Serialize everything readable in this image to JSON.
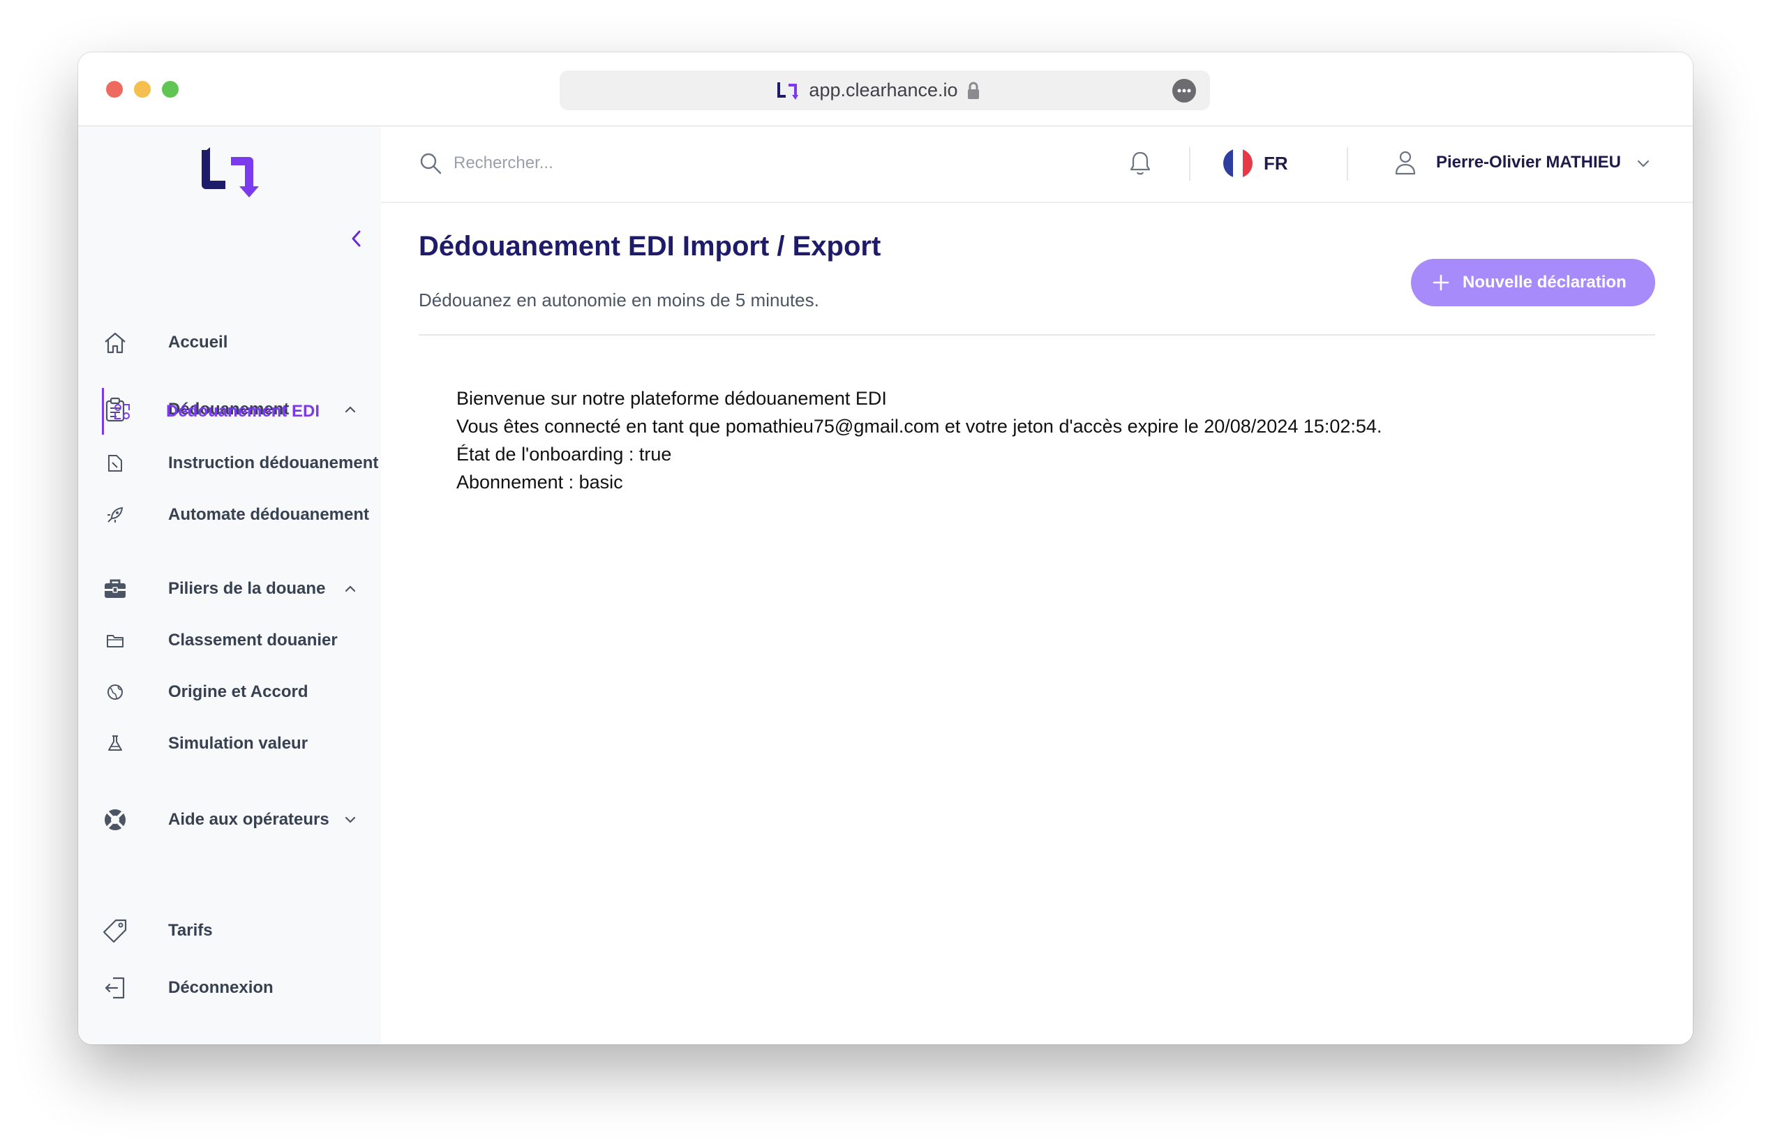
{
  "browser": {
    "url": "app.clearhance.io"
  },
  "sidebar": {
    "items": [
      {
        "label": "Accueil",
        "icon": "home-icon"
      },
      {
        "label": "Dédouanement",
        "icon": "clipboard-icon",
        "expanded": true
      },
      {
        "label": "Dédouanement EDI",
        "icon": "edi-icon",
        "active": true
      },
      {
        "label": "Instruction dédouanement",
        "icon": "document-icon"
      },
      {
        "label": "Automate dédouanement",
        "icon": "rocket-icon"
      },
      {
        "label": "Piliers de la douane",
        "icon": "briefcase-icon",
        "expanded": true
      },
      {
        "label": "Classement douanier",
        "icon": "folder-icon"
      },
      {
        "label": "Origine et Accord",
        "icon": "globe-icon"
      },
      {
        "label": "Simulation valeur",
        "icon": "flask-icon"
      },
      {
        "label": "Aide aux opérateurs",
        "icon": "lifebuoy-icon",
        "expanded": false
      },
      {
        "label": "Tarifs",
        "icon": "tag-icon"
      },
      {
        "label": "Déconnexion",
        "icon": "logout-icon"
      }
    ]
  },
  "header": {
    "search_placeholder": "Rechercher...",
    "language": "FR",
    "user_name": "Pierre-Olivier MATHIEU"
  },
  "main": {
    "title": "Dédouanement EDI Import / Export",
    "subtitle": "Dédouanez en autonomie en moins de 5 minutes.",
    "new_button_label": "Nouvelle déclaration",
    "lines": [
      "Bienvenue sur notre plateforme dédouanement EDI",
      "Vous êtes connecté en tant que pomathieu75@gmail.com et votre jeton d'accès expire le 20/08/2024 15:02:54.",
      "État de l'onboarding : true",
      "Abonnement : basic"
    ]
  },
  "colors": {
    "brand_dark": "#1e1b6b",
    "accent": "#7c3aed",
    "button": "#a78bfa"
  }
}
